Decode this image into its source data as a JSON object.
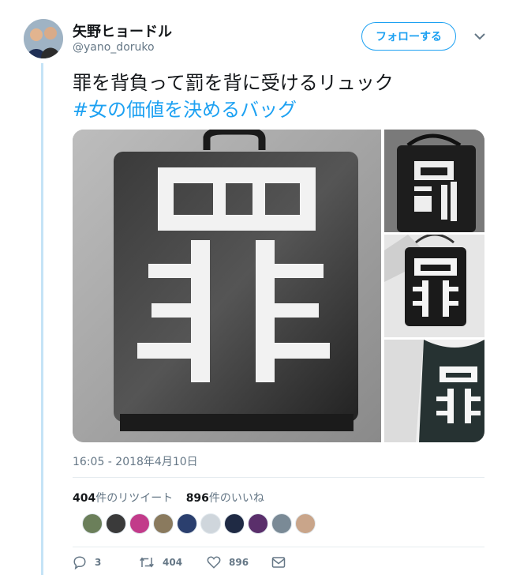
{
  "user": {
    "display_name": "矢野ヒョードル",
    "handle": "@yano_doruko",
    "avatar_icon": "avatar-two-men-photo"
  },
  "follow_button": {
    "label": "フォローする"
  },
  "menu_icon": "chevron-down-icon",
  "tweet": {
    "text_line1": "罪を背負って罰を背に受けるリュック",
    "hashtag": "#女の価値を決めるバッグ"
  },
  "media": {
    "main_kanji": "罪",
    "thumb1_kanji": "罰",
    "thumb2_kanji": "罪",
    "thumb3_kanji": "罪"
  },
  "timestamp": "16:05 - 2018年4月10日",
  "stats": {
    "retweet_count": "404",
    "retweet_label": "件のリツイート",
    "like_count": "896",
    "like_label": "件のいいね"
  },
  "likers": [
    {
      "name": "liker-avatar-1",
      "color": "#6b7f5a"
    },
    {
      "name": "liker-avatar-2",
      "color": "#3a3a3a"
    },
    {
      "name": "liker-avatar-3",
      "color": "#c23b8a"
    },
    {
      "name": "liker-avatar-4",
      "color": "#8a7a5e"
    },
    {
      "name": "liker-avatar-5",
      "color": "#2b3f6e"
    },
    {
      "name": "liker-avatar-6",
      "color": "#cfd6dc"
    },
    {
      "name": "liker-avatar-7",
      "color": "#1f2a44"
    },
    {
      "name": "liker-avatar-8",
      "color": "#5a2f6b"
    },
    {
      "name": "liker-avatar-9",
      "color": "#7a8a96"
    },
    {
      "name": "liker-avatar-10",
      "color": "#c9a58a"
    }
  ],
  "actions": {
    "reply_count": "3",
    "retweet_count": "404",
    "like_count": "896"
  },
  "colors": {
    "accent": "#1da1f2",
    "secondary_text": "#657786",
    "thread_line": "#c4e3f6"
  }
}
